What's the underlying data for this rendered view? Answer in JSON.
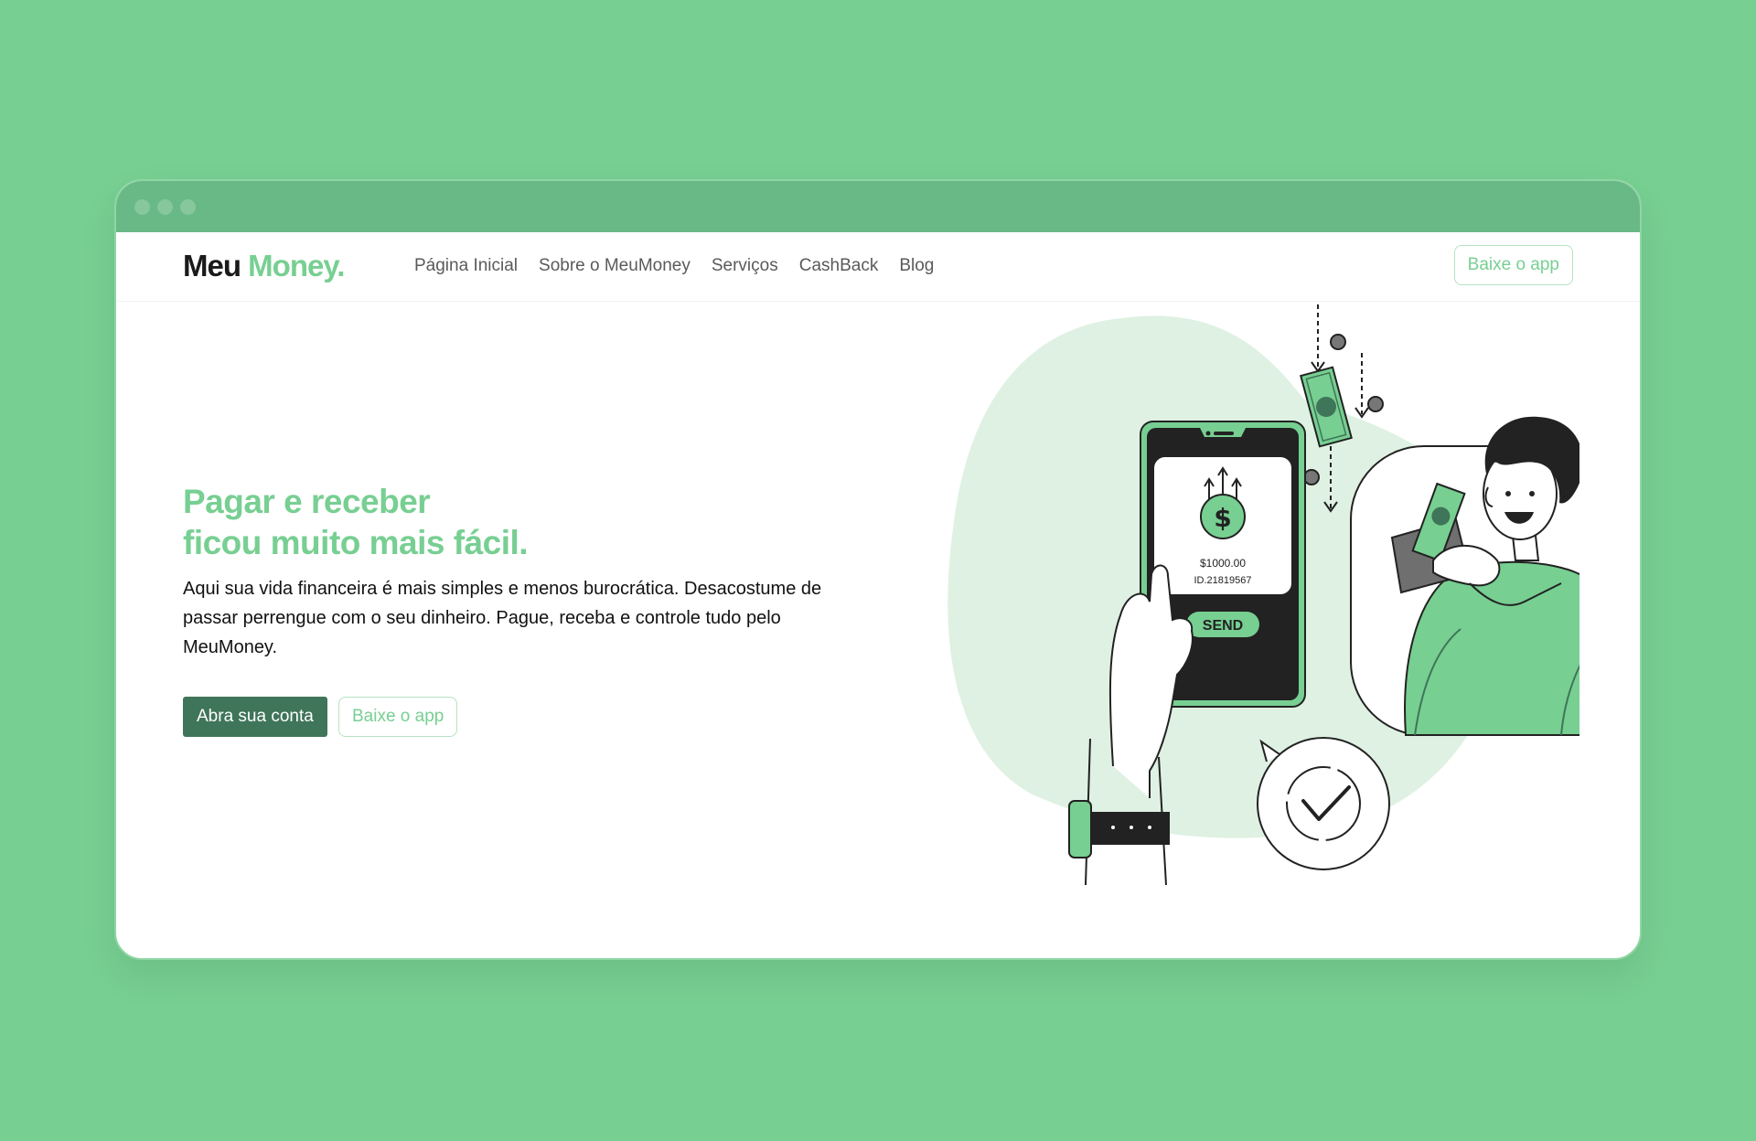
{
  "brand": {
    "part1": "Meu",
    "part2": "Money."
  },
  "nav": {
    "links": [
      {
        "label": "Página Inicial"
      },
      {
        "label": "Sobre o MeuMoney"
      },
      {
        "label": "Serviços"
      },
      {
        "label": "CashBack"
      },
      {
        "label": "Blog"
      }
    ],
    "cta_label": "Baixe o app"
  },
  "hero": {
    "title_line1": "Pagar e receber",
    "title_line2": "ficou muito mais fácil.",
    "description": "Aqui sua vida financeira é mais simples e menos burocrática. Desacostume de passar perrengue com o seu dinheiro. Pague, receba e controle tudo pelo MeuMoney.",
    "primary_button": "Abra sua conta",
    "secondary_button": "Baixe o app"
  },
  "illustration": {
    "amount": "$1000.00",
    "transaction_id": "ID.21819567",
    "send_label": "SEND",
    "dollar_symbol": "$"
  },
  "colors": {
    "background": "#77cf92",
    "titlebar": "#68b986",
    "accent": "#77cf92",
    "primary_button": "#3f7558",
    "blob": "#dff1e2"
  },
  "icons": [
    "window-dot-icon",
    "dollar-coin-icon",
    "check-icon"
  ]
}
